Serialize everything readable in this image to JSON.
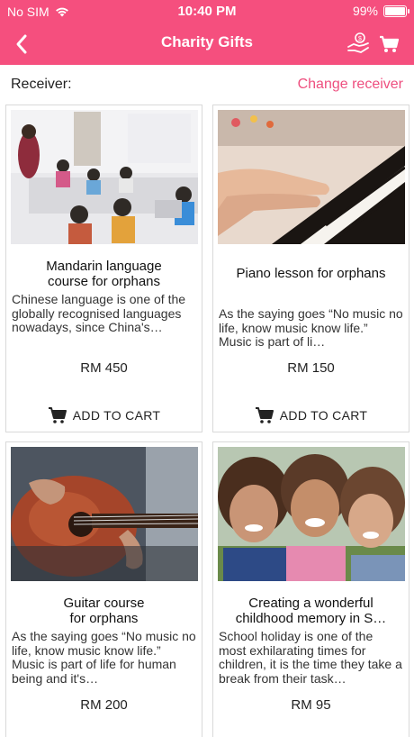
{
  "status_bar": {
    "carrier": "No SIM",
    "time": "10:40 PM",
    "battery_text": "99%",
    "battery_level": 0.99
  },
  "nav": {
    "title": "Charity Gifts",
    "icons": [
      "back-chevron-icon",
      "charity-hand-icon",
      "cart-icon"
    ]
  },
  "receiver": {
    "label": "Receiver:",
    "change_label": "Change receiver"
  },
  "colors": {
    "brand": "#f54f7e",
    "link": "#ee4f7f"
  },
  "add_to_cart_label": "ADD TO CART",
  "products": [
    {
      "title_lines": [
        "Mandarin language",
        "course for orphans"
      ],
      "description": "Chinese language is one of the globally recognised languages nowadays, since China's economical flourishi…",
      "price": "RM 450"
    },
    {
      "title_lines": [
        "Piano lesson for orphans"
      ],
      "description": "As the saying goes “No music no life, know music know life.” Music is part of li…",
      "price": "RM 150"
    },
    {
      "title_lines": [
        "Guitar course",
        "for orphans"
      ],
      "description": "As the saying goes “No music no life, know music know life.” Music is part of life for human being and it's…",
      "price": "RM 200"
    },
    {
      "title_lines": [
        "Creating a wonderful",
        "childhood memory in S…"
      ],
      "description": "School holiday is one of the most exhilarating times for children, it is the time they take a break from their task…",
      "price": "RM 95"
    }
  ]
}
